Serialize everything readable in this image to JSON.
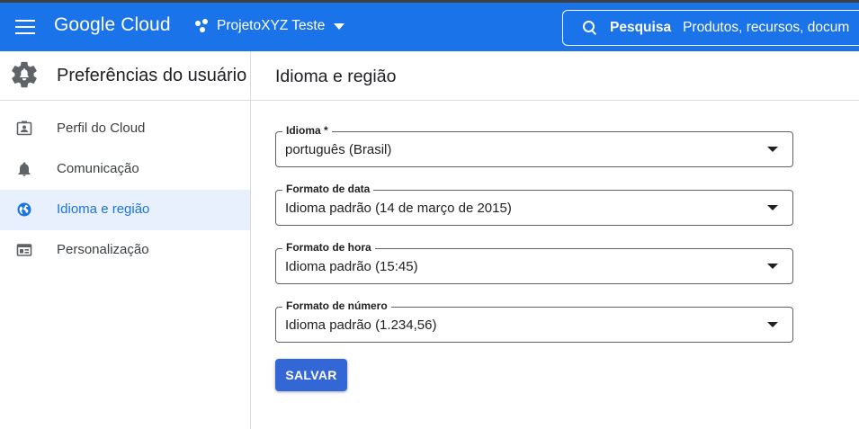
{
  "header": {
    "brand": "Google Cloud",
    "project_name": "ProjetoXYZ Teste",
    "search_label": "Pesquisa",
    "search_placeholder": "Produtos, recursos, docum"
  },
  "sidebar": {
    "title": "Preferências do usuário",
    "items": [
      {
        "label": "Perfil do Cloud",
        "icon": "profile-card-icon",
        "active": false
      },
      {
        "label": "Comunicação",
        "icon": "bell-icon",
        "active": false
      },
      {
        "label": "Idioma e região",
        "icon": "globe-icon",
        "active": true
      },
      {
        "label": "Personalização",
        "icon": "customize-card-icon",
        "active": false
      }
    ]
  },
  "main": {
    "title": "Idioma e região",
    "fields": [
      {
        "label": "Idioma *",
        "value": "português (Brasil)"
      },
      {
        "label": "Formato de data",
        "value": "Idioma padrão (14 de março de 2015)"
      },
      {
        "label": "Formato de hora",
        "value": "Idioma padrão (15:45)"
      },
      {
        "label": "Formato de número",
        "value": "Idioma padrão (1.234,56)"
      }
    ],
    "save_label": "SALVAR"
  },
  "colors": {
    "brand_blue": "#1a73e8",
    "button_blue": "#3367d6",
    "active_bg": "#e8f0fe"
  }
}
